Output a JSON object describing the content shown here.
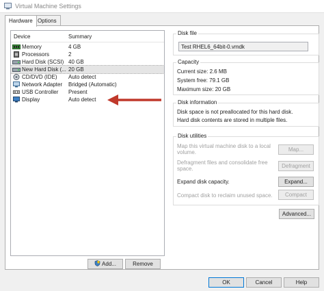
{
  "window": {
    "title": "Virtual Machine Settings"
  },
  "tabs": [
    {
      "label": "Hardware",
      "active": true
    },
    {
      "label": "Options",
      "active": false
    }
  ],
  "device_list": {
    "headers": {
      "device": "Device",
      "summary": "Summary"
    },
    "rows": [
      {
        "name": "Memory",
        "summary": "4 GB",
        "icon": "memory-icon",
        "selected": false
      },
      {
        "name": "Processors",
        "summary": "2",
        "icon": "processor-icon",
        "selected": false
      },
      {
        "name": "Hard Disk (SCSI)",
        "summary": "40 GB",
        "icon": "hard-disk-icon",
        "selected": false
      },
      {
        "name": "New Hard Disk (...",
        "summary": "20 GB",
        "icon": "hard-disk-icon",
        "selected": true
      },
      {
        "name": "CD/DVD (IDE)",
        "summary": "Auto detect",
        "icon": "cd-dvd-icon",
        "selected": false
      },
      {
        "name": "Network Adapter",
        "summary": "Bridged (Automatic)",
        "icon": "network-adapter-icon",
        "selected": false
      },
      {
        "name": "USB Controller",
        "summary": "Present",
        "icon": "usb-icon",
        "selected": false
      },
      {
        "name": "Display",
        "summary": "Auto detect",
        "icon": "display-icon",
        "selected": false
      }
    ],
    "add_label": "Add...",
    "remove_label": "Remove"
  },
  "disk_file": {
    "label": "Disk file",
    "value": "Test RHEL6_64bit-0.vmdk"
  },
  "capacity": {
    "label": "Capacity",
    "current_size": "Current size: 2.6 MB",
    "system_free": "System free: 79.1 GB",
    "maximum_size": "Maximum size: 20 GB"
  },
  "disk_information": {
    "label": "Disk information",
    "line1": "Disk space is not preallocated for this hard disk.",
    "line2": "Hard disk contents are stored in multiple files."
  },
  "disk_utilities": {
    "label": "Disk utilities",
    "map_text_1": "Map this virtual machine disk to a local",
    "map_text_2": "volume.",
    "map_label": "Map...",
    "defrag_text_1": "Defragment files and consolidate free",
    "defrag_text_2": "space.",
    "defrag_label": "Defragment",
    "expand_text": "Expand disk capacity.",
    "expand_label": "Expand...",
    "compact_text": "Compact disk to reclaim unused space.",
    "compact_label": "Compact"
  },
  "advanced_label": "Advanced...",
  "footer": {
    "ok": "OK",
    "cancel": "Cancel",
    "help": "Help"
  },
  "colors": {
    "arrow": "#c0392b",
    "accent": "#0078d7"
  }
}
